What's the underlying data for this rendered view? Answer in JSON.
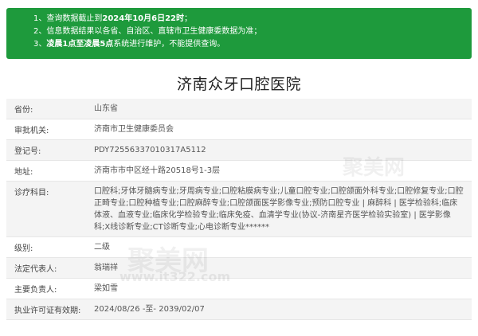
{
  "notice": {
    "line1_prefix": "1、查询数据截止到",
    "line1_date": "2024年10月6日22时",
    "line1_suffix": "；",
    "line2": "2、信息数据结果以各省、自治区、直辖市卫生健康委数据为准；",
    "line3_prefix": "3、",
    "line3_bold": "凌晨1点至凌晨5点",
    "line3_suffix": "系统进行维护，不能提供查询。"
  },
  "title": "济南众牙口腔医院",
  "rows": [
    {
      "key": "省份:",
      "value": "山东省"
    },
    {
      "key": "审批机关:",
      "value": "济南市卫生健康委员会"
    },
    {
      "key": "登记号:",
      "value": "PDY72556337010317A5112"
    },
    {
      "key": "地址:",
      "value": "济南市市中区经十路20518号1-3层"
    },
    {
      "key": "诊疗科目:",
      "value": "口腔科;牙体牙髓病专业;牙周病专业;口腔粘膜病专业;儿童口腔专业;口腔颌面外科专业;口腔修复专业;口腔正畸专业;口腔种植专业;口腔麻醉专业;口腔颌面医学影像专业;预防口腔专业 | 麻醉科 | 医学检验科;临床体液、血液专业;临床化学检验专业;临床免疫、血清学专业(协议-济南星齐医学检验实验室) | 医学影像科;X线诊断专业;CT诊断专业;心电诊断专业******"
    },
    {
      "key": "级别:",
      "value": "二级"
    },
    {
      "key": "法定代表人:",
      "value": "翁瑞祥"
    },
    {
      "key": "主要负责人:",
      "value": "梁如雪"
    },
    {
      "key": "执业许可证有效期:",
      "value": "2024/08/26 -至- 2039/02/07"
    }
  ],
  "watermark": {
    "text": "聚美网",
    "url": "www.it322.com"
  }
}
